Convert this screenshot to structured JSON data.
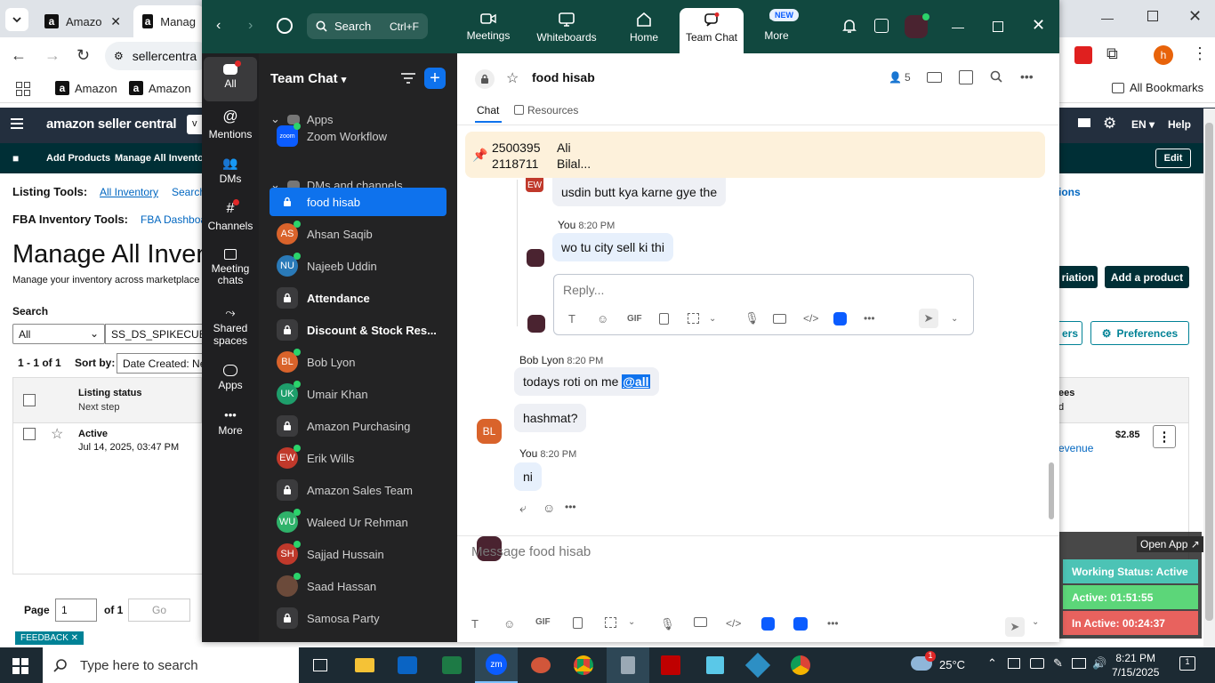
{
  "browser": {
    "tabs": [
      {
        "label": "Amazo"
      },
      {
        "label": "Manag"
      }
    ],
    "url": "sellercentra",
    "bookmarks": [
      "Amazon",
      "Amazon"
    ],
    "all_bookmarks": "All Bookmarks",
    "profile_initial": "h"
  },
  "amazon": {
    "logo": "amazon seller central",
    "nav_lang": "EN",
    "nav_help": "Help",
    "sub_links": [
      "Add Products",
      "Manage All Inventory"
    ],
    "edit_label": "Edit",
    "listing_tools_label": "Listing Tools:",
    "listing_tools_links": [
      "All Inventory",
      "Search"
    ],
    "fba_tools_label": "FBA Inventory Tools:",
    "fba_link": "FBA Dashboa",
    "right_link": "ions",
    "page_title": "Manage All Inven",
    "page_subtitle": "Manage your inventory across marketplace",
    "search_label": "Search",
    "search_select": "All",
    "search_value": "SS_DS_SPIKECUB",
    "result_count": "1 - 1 of 1",
    "sort_label": "Sort by:",
    "sort_value": "Date Created: New",
    "variation_btn": "riation",
    "add_product_btn": "Add a product",
    "filters_btn": "ers",
    "preferences_btn": "Preferences",
    "col_listing_status": "Listing status",
    "col_next_step": "Next step",
    "col_fees": "ees",
    "col_fees_sub": "d",
    "row_status": "Active",
    "row_date": "Jul 14, 2025, 03:47 PM",
    "row_price": "$2.85",
    "row_revenue": "evenue",
    "page_label": "Page",
    "page_value": "1",
    "page_of": "of 1",
    "go_label": "Go",
    "feedback": "FEEDBACK"
  },
  "zoom": {
    "search_label": "Search",
    "search_shortcut": "Ctrl+F",
    "top_nav": [
      {
        "label": "Meetings",
        "icon": "video-icon"
      },
      {
        "label": "Whiteboards",
        "icon": "whiteboard-icon"
      },
      {
        "label": "Home",
        "icon": "home-icon"
      },
      {
        "label": "Team Chat",
        "icon": "chat-icon"
      },
      {
        "label": "More",
        "icon": "more-icon"
      }
    ],
    "new_badge": "NEW",
    "rail": [
      "All",
      "Mentions",
      "DMs",
      "Channels",
      "Meeting chats",
      "Shared spaces",
      "Apps",
      "More"
    ],
    "sidebar_title": "Team Chat",
    "section_apps": "Apps",
    "section_dms": "DMs and channels",
    "items": [
      {
        "label": "Zoom Workflow",
        "type": "app"
      },
      {
        "label": "food hisab",
        "type": "lock",
        "selected": true
      },
      {
        "label": "Ahsan Saqib",
        "initials": "AS",
        "color": "#d9632b"
      },
      {
        "label": "Najeeb Uddin",
        "initials": "NU",
        "color": "#2a7ab8"
      },
      {
        "label": "Attendance",
        "type": "lock",
        "bold": true
      },
      {
        "label": "Discount & Stock Res...",
        "type": "lock",
        "bold": true
      },
      {
        "label": "Bob Lyon",
        "initials": "BL",
        "color": "#d9632b"
      },
      {
        "label": "Umair Khan",
        "initials": "UK",
        "color": "#1e9e6b"
      },
      {
        "label": "Amazon Purchasing",
        "type": "lock"
      },
      {
        "label": "Erik Wills",
        "initials": "EW",
        "color": "#c0392b"
      },
      {
        "label": "Amazon Sales Team",
        "type": "lock"
      },
      {
        "label": "Waleed Ur Rehman",
        "initials": "WU",
        "color": "#2fb26a"
      },
      {
        "label": "Sajjad Hussain",
        "initials": "SH",
        "color": "#c0392b"
      },
      {
        "label": "Saad Hassan",
        "initials": "",
        "color": "#6b4a3a"
      },
      {
        "label": "Samosa Party",
        "type": "lock"
      }
    ],
    "chat_name": "food hisab",
    "member_count": "5",
    "tabs": [
      "Chat",
      "Resources"
    ],
    "pinned_left": [
      "2500395",
      "2118711"
    ],
    "pinned_right": [
      "Ali",
      "Bilal..."
    ],
    "thread": [
      {
        "text": "usdin butt kya karne gye the",
        "avatar": "EW"
      },
      {
        "sender": "You",
        "time": "8:20 PM",
        "text": "wo tu city sell ki thi"
      }
    ],
    "reply_placeholder": "Reply...",
    "msg_bob": {
      "sender": "Bob Lyon",
      "time": "8:20 PM",
      "initials": "BL",
      "text": "todays roti on me",
      "mention": "@all",
      "text2": "hashmat?"
    },
    "msg_you": {
      "sender": "You",
      "time": "8:20 PM",
      "text": "ni"
    },
    "compose_placeholder": "Message food hisab",
    "gif": "GIF"
  },
  "widget": {
    "open_app": "Open App ↗",
    "working": "Working Status: Active",
    "active": "Active: 01:51:55",
    "inactive": "In Active: 00:24:37",
    "colors": {
      "working": "#4cc3b5",
      "active": "#5cd679",
      "inactive": "#e8625e"
    }
  },
  "taskbar": {
    "search_placeholder": "Type here to search",
    "weather": "25°C",
    "weather_badge": "1",
    "time": "8:21 PM",
    "date": "7/15/2025",
    "notif": "1"
  }
}
